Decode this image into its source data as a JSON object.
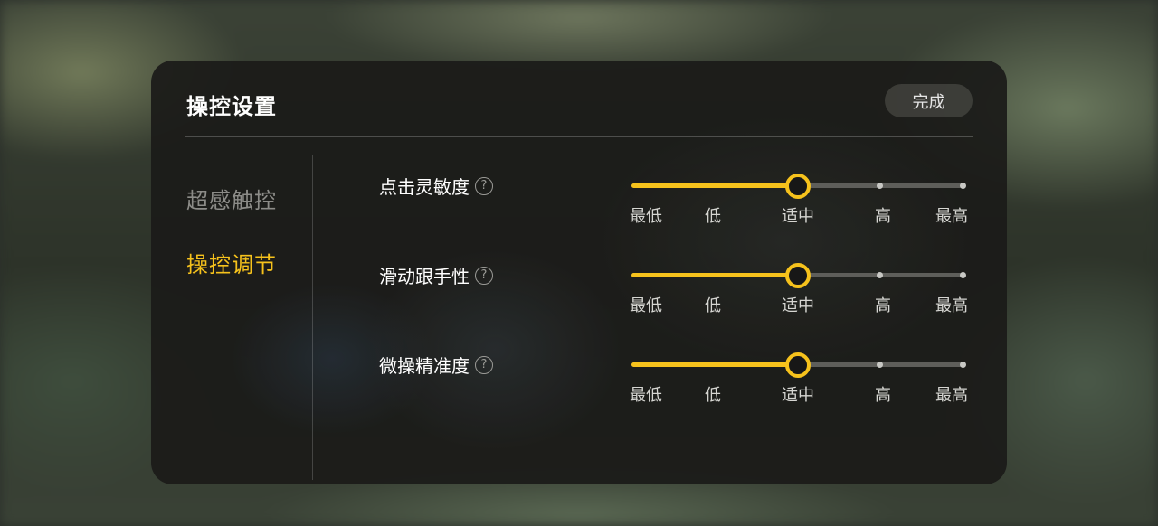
{
  "header": {
    "title": "操控设置",
    "done_label": "完成"
  },
  "sidebar": {
    "items": [
      {
        "label": "超感触控",
        "active": false
      },
      {
        "label": "操控调节",
        "active": true
      }
    ]
  },
  "settings": [
    {
      "label": "点击灵敏度",
      "help_icon": "question-circle-icon",
      "levels": [
        "最低",
        "低",
        "适中",
        "高",
        "最高"
      ],
      "selected": "适中"
    },
    {
      "label": "滑动跟手性",
      "help_icon": "question-circle-icon",
      "levels": [
        "最低",
        "低",
        "适中",
        "高",
        "最高"
      ],
      "selected": "适中"
    },
    {
      "label": "微操精准度",
      "help_icon": "question-circle-icon",
      "levels": [
        "最低",
        "低",
        "适中",
        "高",
        "最高"
      ],
      "selected": "适中"
    }
  ],
  "colors": {
    "accent": "#f6c21c",
    "panel": "#1b1b19",
    "text": "#ffffff",
    "muted": "#8c8c88"
  }
}
